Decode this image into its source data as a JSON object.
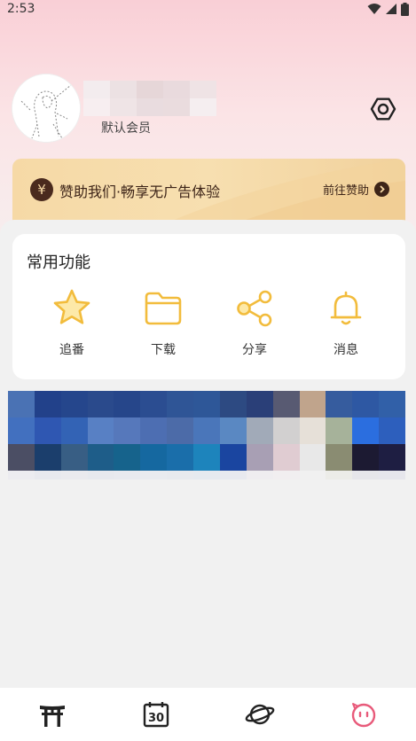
{
  "status_bar": {
    "time": "2:53"
  },
  "profile": {
    "member_label": "默认会员"
  },
  "sponsor": {
    "icon_char": "¥",
    "text": "赞助我们·畅享无广告体验",
    "link": "前往赞助"
  },
  "functions": {
    "title": "常用功能",
    "items": [
      {
        "label": "追番",
        "icon": "star-icon"
      },
      {
        "label": "下载",
        "icon": "folder-icon"
      },
      {
        "label": "分享",
        "icon": "share-icon"
      },
      {
        "label": "消息",
        "icon": "bell-icon"
      }
    ]
  },
  "bottom_nav": {
    "items": [
      {
        "icon": "torii-gate-icon"
      },
      {
        "icon": "calendar-30-icon"
      },
      {
        "icon": "planet-icon"
      },
      {
        "icon": "face-icon",
        "active": true
      }
    ]
  },
  "colors": {
    "accent": "#f5c44a",
    "nav_active": "#e85a7a",
    "sponsor_dark": "#3d2418"
  }
}
